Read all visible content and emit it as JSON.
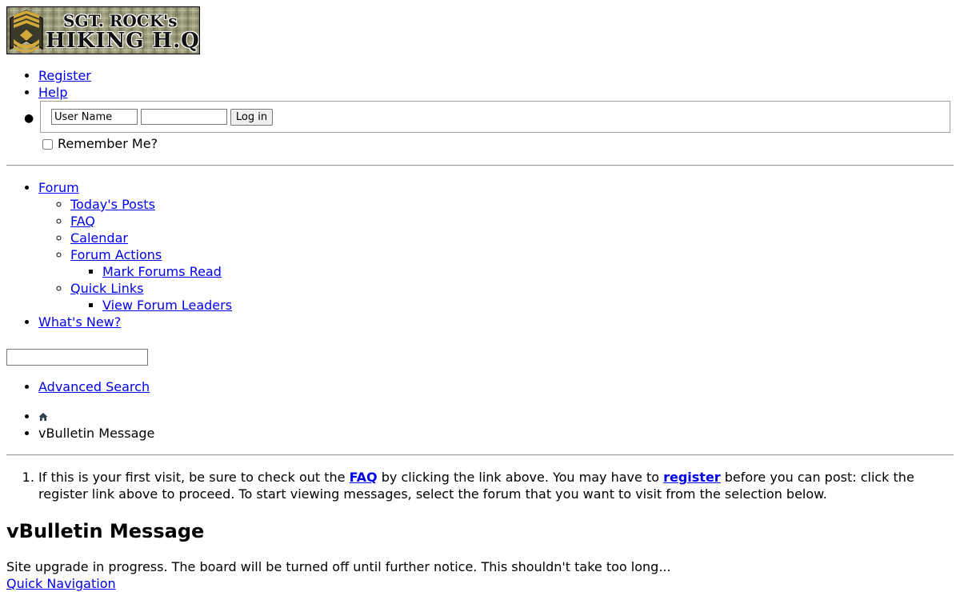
{
  "logo": {
    "line1": "SGT. ROCK's",
    "line2": "HIKING H.Q.",
    "colors": {
      "camo": "#9a9a7a",
      "badge": "#d4a93a",
      "badge_dark": "#3a3a2a"
    }
  },
  "top_links": [
    {
      "label": "Register"
    },
    {
      "label": "Help"
    }
  ],
  "login": {
    "username_value": "User Name",
    "password_value": "",
    "button_label": "Log in",
    "remember_label": "Remember Me?"
  },
  "nav": {
    "forum": "Forum",
    "todays_posts": "Today's Posts",
    "faq": "FAQ",
    "calendar": "Calendar",
    "forum_actions": "Forum Actions",
    "mark_forums_read": "Mark Forums Read",
    "quick_links": "Quick Links",
    "view_forum_leaders": "View Forum Leaders",
    "whats_new": "What's New?"
  },
  "search": {
    "value": "",
    "advanced_label": "Advanced Search"
  },
  "breadcrumb": {
    "home_icon": "home-icon",
    "current": "vBulletin Message"
  },
  "notice": {
    "part1": "If this is your first visit, be sure to check out the ",
    "faq_link": "FAQ",
    "part2": " by clicking the link above. You may have to ",
    "register_link": "register",
    "part3": " before you can post: click the register link above to proceed. To start viewing messages, select the forum that you want to visit from the selection below."
  },
  "message": {
    "title": "vBulletin Message",
    "body": "Site upgrade in progress. The board will be turned off until further notice. This shouldn't take too long...",
    "quick_nav": "Quick Navigation"
  }
}
